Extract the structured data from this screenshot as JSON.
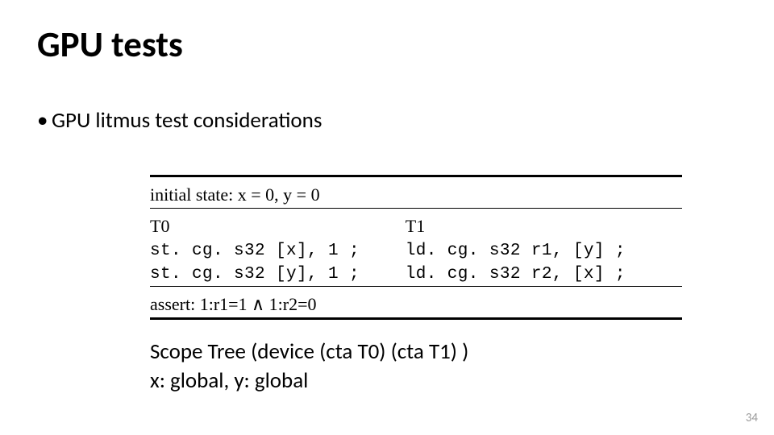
{
  "title": "GPU tests",
  "bullet1": "GPU litmus test considerations",
  "table": {
    "initial": "initial state: x = 0, y = 0",
    "t0_header": "T0",
    "t1_header": "T1",
    "t0_line1": "st. cg. s32 [x], 1 ;",
    "t0_line2": "st. cg. s32 [y], 1 ;",
    "t1_line1": "ld. cg. s32 r1, [y] ;",
    "t1_line2": "ld. cg. s32 r2, [x] ;",
    "assert": "assert: 1:r1=1 ∧ 1:r2=0"
  },
  "caption": {
    "line1": "Scope Tree (device (cta T0) (cta T1) )",
    "line2": "x: global, y: global"
  },
  "page_number": "34"
}
